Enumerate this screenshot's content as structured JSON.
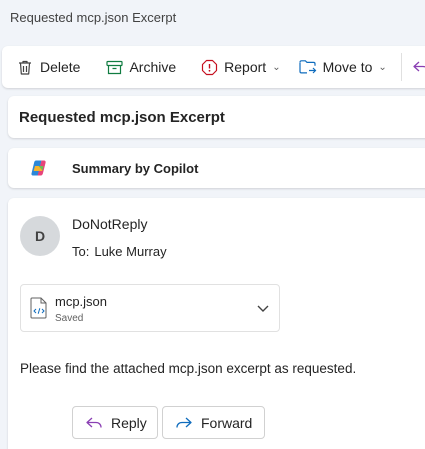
{
  "window": {
    "title": "Requested mcp.json Excerpt"
  },
  "toolbar": {
    "delete_label": "Delete",
    "archive_label": "Archive",
    "report_label": "Report",
    "move_label": "Move to"
  },
  "message": {
    "subject": "Requested mcp.json Excerpt",
    "copilot_label": "Summary by Copilot",
    "avatar_initial": "D",
    "sender": "DoNotReply",
    "to_label": "To:",
    "to_name": "Luke Murray",
    "attachment": {
      "name": "mcp.json",
      "status": "Saved"
    },
    "body": "Please find the attached mcp.json excerpt as requested.",
    "reply_label": "Reply",
    "forward_label": "Forward"
  },
  "colors": {
    "background": "#f1f4f9",
    "archive_icon": "#107c41",
    "report_icon": "#c50f1f",
    "move_icon": "#0f6cbd",
    "reply_icon": "#8a3fb3",
    "forward_icon": "#0f6cbd"
  },
  "icons": [
    "delete-icon",
    "archive-icon",
    "report-icon",
    "move-to-icon",
    "reply-all-icon",
    "copilot-icon",
    "file-icon",
    "chevron-down-icon",
    "reply-icon",
    "forward-icon"
  ]
}
